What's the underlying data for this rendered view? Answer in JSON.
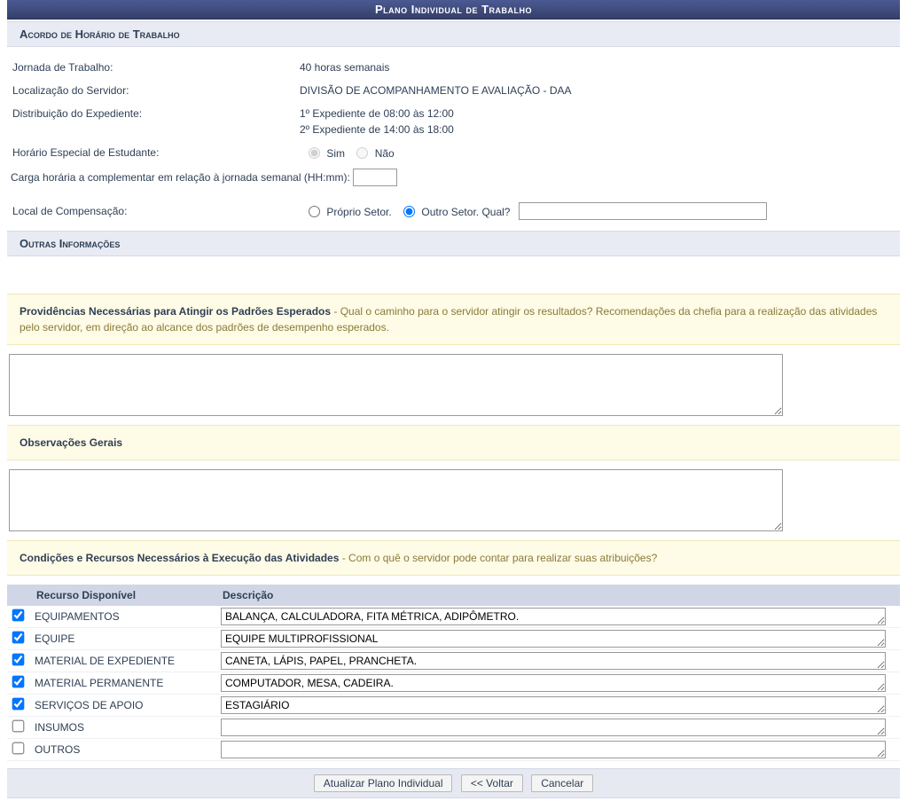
{
  "title": "Plano Individual de Trabalho",
  "sections": {
    "acordo": {
      "header": "Acordo de Horário de Trabalho",
      "jornada_label": "Jornada de Trabalho:",
      "jornada_value": "40 horas semanais",
      "local_label": "Localização do Servidor:",
      "local_value": "DIVISÃO DE ACOMPANHAMENTO E AVALIAÇÃO - DAA",
      "dist_label": "Distribuição do Expediente:",
      "dist_line1": "1º Expediente de 08:00 às 12:00",
      "dist_line2": "2º Expediente de 14:00 às 18:00",
      "horario_esp_label": "Horário Especial de Estudante:",
      "radio_sim": "Sim",
      "radio_nao": "Não",
      "horario_esp_selected": "sim",
      "carga_label": "Carga horária a complementar em relação à jornada semanal (HH:mm):",
      "carga_value": "",
      "local_comp_label": "Local de Compensação:",
      "radio_proprio": "Próprio Setor.",
      "radio_outro": "Outro Setor. Qual?",
      "local_comp_selected": "outro",
      "outro_setor_value": ""
    },
    "outras": {
      "header": "Outras Informações",
      "providencias_title": "Providências Necessárias para Atingir os Padrões Esperados",
      "providencias_desc": " - Qual o caminho para o servidor atingir os resultados? Recomendações da chefia para a realização das atividades pelo servidor, em direção ao alcance dos padrões de desempenho esperados.",
      "providencias_value": "",
      "obs_title": "Observações Gerais",
      "obs_value": "",
      "cond_title": "Condições e Recursos Necessários à Execução das Atividades",
      "cond_desc": " - Com o quê o servidor pode contar para realizar suas atribuições?"
    }
  },
  "resource_headers": {
    "col1": "Recurso Disponível",
    "col2": "Descrição"
  },
  "resources": [
    {
      "checked": true,
      "name": "EQUIPAMENTOS",
      "desc": "BALANÇA, CALCULADORA, FITA MÉTRICA, ADIPÔMETRO."
    },
    {
      "checked": true,
      "name": "EQUIPE",
      "desc": "EQUIPE MULTIPROFISSIONAL"
    },
    {
      "checked": true,
      "name": "MATERIAL DE EXPEDIENTE",
      "desc": "CANETA, LÁPIS, PAPEL, PRANCHETA."
    },
    {
      "checked": true,
      "name": "MATERIAL PERMANENTE",
      "desc": "COMPUTADOR, MESA, CADEIRA."
    },
    {
      "checked": true,
      "name": "SERVIÇOS DE APOIO",
      "desc": "ESTAGIÁRIO"
    },
    {
      "checked": false,
      "name": "INSUMOS",
      "desc": ""
    },
    {
      "checked": false,
      "name": "OUTROS",
      "desc": ""
    }
  ],
  "buttons": {
    "atualizar": "Atualizar Plano Individual",
    "voltar": "<< Voltar",
    "cancelar": "Cancelar"
  }
}
